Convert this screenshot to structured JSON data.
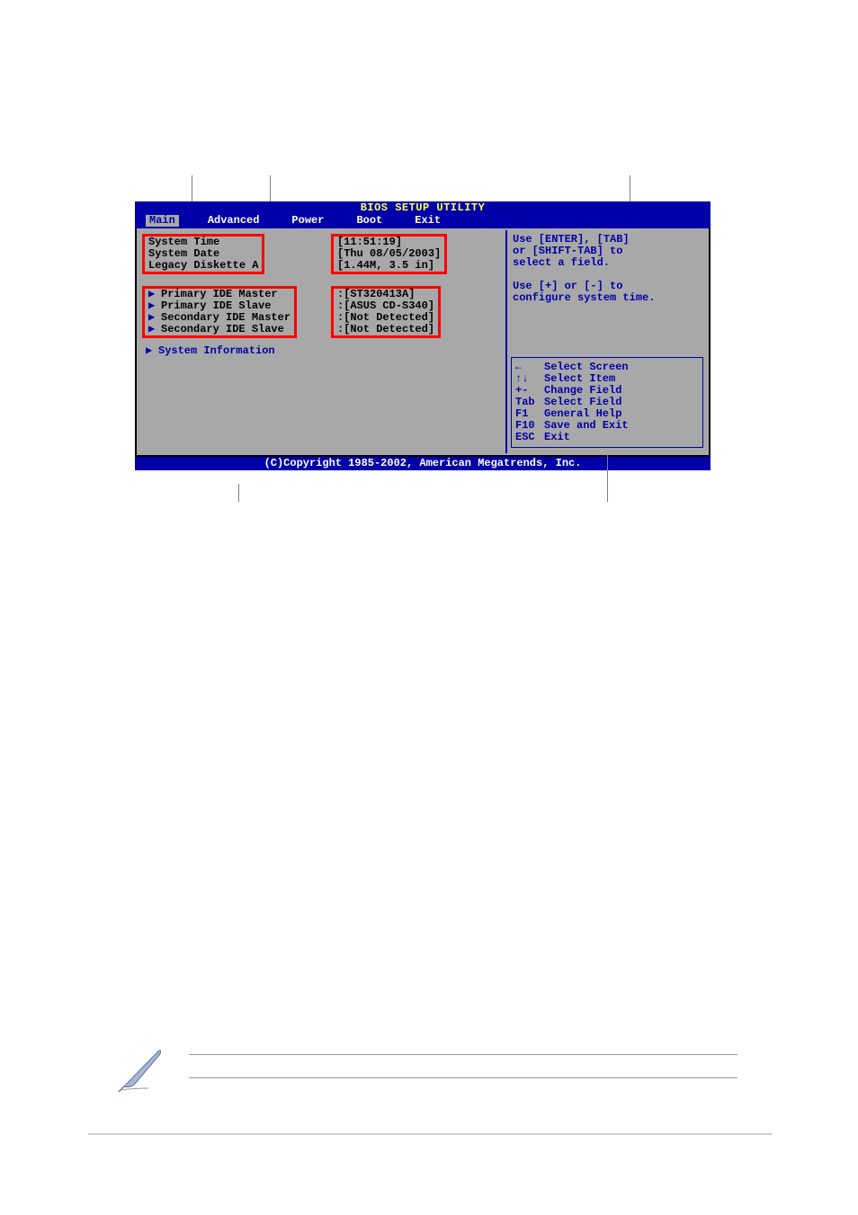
{
  "title": "BIOS SETUP UTILITY",
  "menu": {
    "main": "Main",
    "advanced": "Advanced",
    "power": "Power",
    "boot": "Boot",
    "exit": "Exit"
  },
  "fields": {
    "system_time_label": "System Time",
    "system_date_label": "System Date",
    "legacy_diskette_label": "Legacy Diskette A",
    "system_time_value": "[11:51:19]",
    "system_date_value": "[Thu 08/05/2003]",
    "legacy_diskette_value": "[1.44M, 3.5 in]",
    "primary_ide_master_label": "Primary IDE Master",
    "primary_ide_slave_label": "Primary IDE Slave",
    "secondary_ide_master_label": "Secondary IDE Master",
    "secondary_ide_slave_label": "Secondary IDE Slave",
    "primary_ide_master_value": ":[ST320413A]",
    "primary_ide_slave_value": ":[ASUS CD-S340]",
    "secondary_ide_master_value": ":[Not Detected]",
    "secondary_ide_slave_value": ":[Not Detected]",
    "system_information_label": "System Information"
  },
  "help": {
    "line1": "Use [ENTER], [TAB]",
    "line2": "or [SHIFT-TAB] to",
    "line3": "select a field.",
    "line4": "Use [+] or [-] to",
    "line5": "configure system time."
  },
  "nav": {
    "arrow_left": "←",
    "arrows_ud": "↑↓",
    "plusminus": "+-",
    "tab": "Tab",
    "f1": "F1",
    "f10": "F10",
    "esc": "ESC",
    "select_screen": "Select Screen",
    "select_item": "Select Item",
    "change_field": "Change Field",
    "select_field": "Select Field",
    "general_help": "General Help",
    "save_exit": "Save and Exit",
    "exit": "Exit"
  },
  "footer": "(C)Copyright 1985-2002, American Megatrends, Inc."
}
